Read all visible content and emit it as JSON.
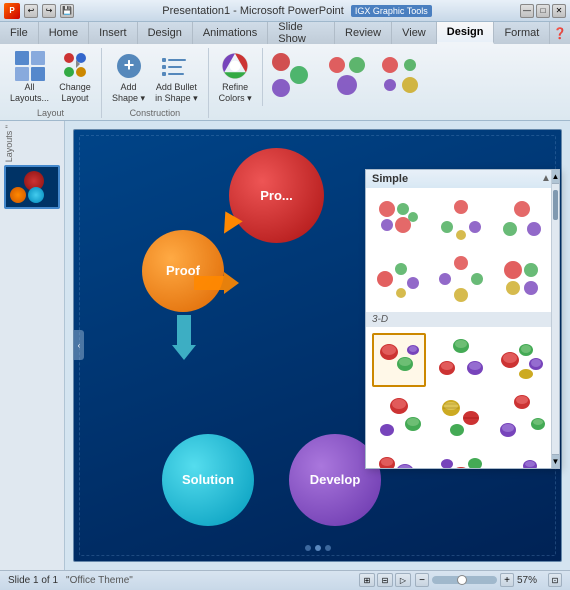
{
  "titleBar": {
    "title": "Presentation1 - Microsoft PowerPoint",
    "igxLabel": "IGX Graphic Tools",
    "logoText": "P",
    "minBtn": "—",
    "maxBtn": "□",
    "closeBtn": "✕"
  },
  "ribbonTabs": [
    {
      "label": "File",
      "active": false
    },
    {
      "label": "Home",
      "active": false
    },
    {
      "label": "Insert",
      "active": false
    },
    {
      "label": "Design",
      "active": false
    },
    {
      "label": "Animations",
      "active": false
    },
    {
      "label": "Slide Show",
      "active": false
    },
    {
      "label": "Review",
      "active": false
    },
    {
      "label": "View",
      "active": false
    },
    {
      "label": "Design",
      "active": true
    },
    {
      "label": "Format",
      "active": false
    }
  ],
  "layoutGroup": {
    "label": "Layout",
    "allLayoutsBtn": "All\nLayouts...",
    "changeLayoutBtn": "Change\nLayout",
    "dropdownArrow": "▾"
  },
  "constructionGroup": {
    "label": "Construction",
    "addShapeBtn": "Add\nShape",
    "addBulletBtn": "Add Bullet\nin Shape",
    "dropdownArrow": "▾"
  },
  "refineGroup": {
    "refineColorsBtn": "Refine\nColors",
    "dropdownArrow": "▾"
  },
  "dropdown": {
    "title": "Simple",
    "sections": [
      {
        "label": "",
        "items": [
          {
            "id": "s1",
            "selected": false
          },
          {
            "id": "s2",
            "selected": false
          },
          {
            "id": "s3",
            "selected": false
          },
          {
            "id": "s4",
            "selected": false
          },
          {
            "id": "s5",
            "selected": false
          },
          {
            "id": "s6",
            "selected": false
          }
        ]
      },
      {
        "label": "3-D",
        "items": [
          {
            "id": "d1",
            "selected": true
          },
          {
            "id": "d2",
            "selected": false
          },
          {
            "id": "d3",
            "selected": false
          },
          {
            "id": "d4",
            "selected": false
          },
          {
            "id": "d5",
            "selected": false
          },
          {
            "id": "d6",
            "selected": false
          }
        ]
      }
    ]
  },
  "slide": {
    "circles": [
      {
        "label": "Pro...",
        "class": "circle-proof-top"
      },
      {
        "label": "Proof",
        "class": "circle-proof"
      },
      {
        "label": "Solution",
        "class": "circle-solution"
      },
      {
        "label": "Develop",
        "class": "circle-develop"
      }
    ]
  },
  "statusBar": {
    "slideInfo": "Slide 1 of 1",
    "theme": "\"Office Theme\"",
    "zoomLevel": "57%"
  }
}
